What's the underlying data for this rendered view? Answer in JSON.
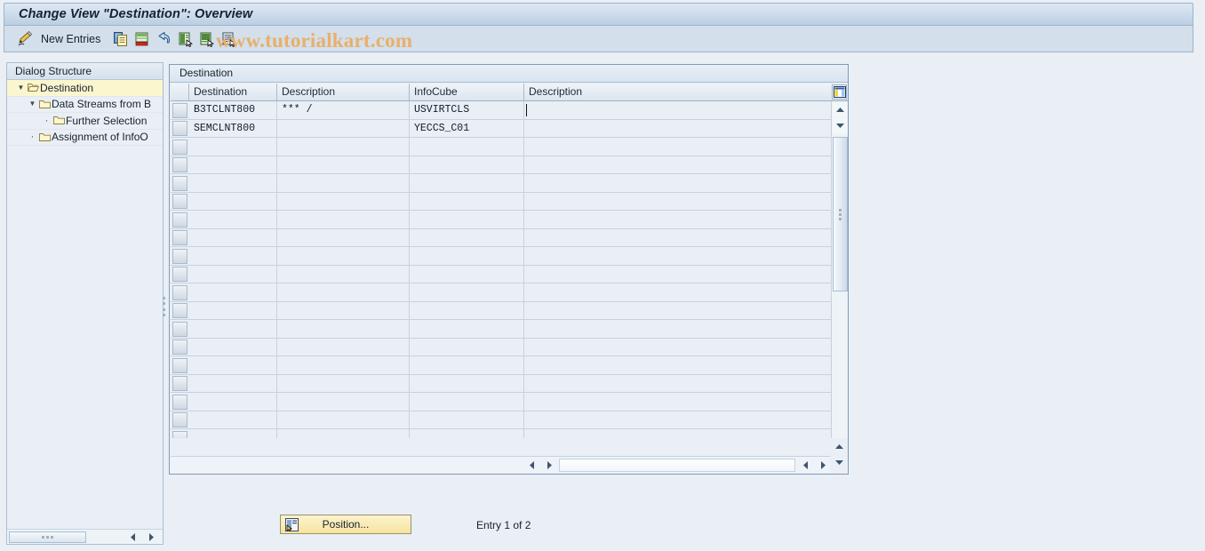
{
  "window": {
    "title": "Change View \"Destination\": Overview"
  },
  "toolbar": {
    "new_entries_label": "New Entries",
    "icons": [
      {
        "name": "new-entries-pencil-icon"
      },
      {
        "name": "copy-icon"
      },
      {
        "name": "delete-row-icon"
      },
      {
        "name": "undo-icon"
      },
      {
        "name": "select-layout-icon"
      },
      {
        "name": "variant-icon"
      },
      {
        "name": "details-icon"
      }
    ]
  },
  "watermark": {
    "text": "www.tutorialkart.com",
    "color": "#e8b06a"
  },
  "sidebar": {
    "header": "Dialog Structure",
    "items": [
      {
        "label": "Destination",
        "level": 0,
        "expanded": true,
        "selected": true,
        "icon": "open-folder-icon"
      },
      {
        "label": "Data Streams from B",
        "level": 1,
        "expanded": true,
        "selected": false,
        "icon": "folder-icon"
      },
      {
        "label": "Further Selection",
        "level": 2,
        "expanded": false,
        "selected": false,
        "icon": "folder-icon"
      },
      {
        "label": "Assignment of InfoO",
        "level": 1,
        "expanded": false,
        "selected": false,
        "icon": "folder-icon"
      }
    ]
  },
  "table": {
    "caption": "Destination",
    "columns": [
      "Destination",
      "Description",
      "InfoCube",
      "Description"
    ],
    "rows": [
      [
        "B3TCLNT800",
        "*** /",
        "USVIRTCLS",
        ""
      ],
      [
        "SEMCLNT800",
        "",
        "YECCS_C01",
        ""
      ]
    ],
    "empty_row_count": 18,
    "cursor_row": 0,
    "cursor_column": 3,
    "config_icon": "column-settings-icon"
  },
  "footer": {
    "position_button_label": "Position...",
    "position_button_icon": "position-icon",
    "entry_status": "Entry 1 of 2"
  },
  "colors": {
    "title_bar": "#cfdded",
    "toolbar": "#d3dfeb",
    "page_bg": "#eaeff5",
    "selected_tree": "#fcf6cf",
    "button_yellow": "#f6e49e"
  }
}
